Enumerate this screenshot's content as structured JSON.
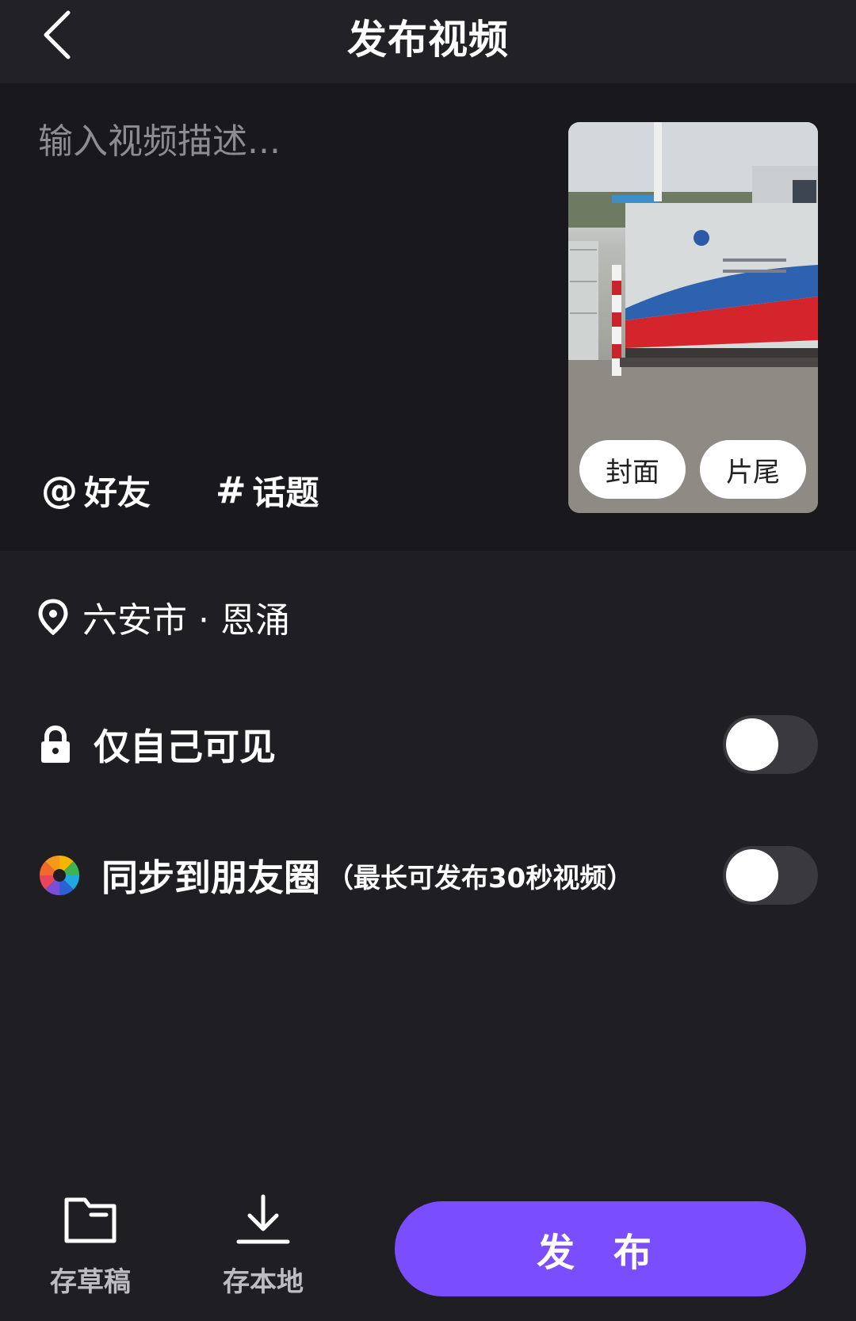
{
  "header": {
    "title": "发布视频",
    "back_icon": "chevron-left-icon"
  },
  "compose": {
    "description_placeholder": "输入视频描述...",
    "description_value": "",
    "mention": {
      "symbol": "@",
      "label": "好友"
    },
    "topic": {
      "symbol": "#",
      "label": "话题"
    }
  },
  "thumbnail": {
    "cover_label": "封面",
    "ending_label": "片尾"
  },
  "location": {
    "icon": "map-pin-icon",
    "text": "六安市 · 恩涌"
  },
  "options": {
    "private": {
      "icon": "lock-icon",
      "label": "仅自己可见",
      "enabled": false
    },
    "moments": {
      "icon": "moments-aperture-icon",
      "label": "同步到朋友圈",
      "note": "（最长可发布30秒视频）",
      "enabled": false
    }
  },
  "bottom_bar": {
    "draft_label": "存草稿",
    "save_local_label": "存本地",
    "publish_label": "发 布"
  },
  "colors": {
    "background": "#1f1e22",
    "compose_panel": "#19181c",
    "accent": "#7a4dff",
    "toggle_off": "#3a393e"
  }
}
